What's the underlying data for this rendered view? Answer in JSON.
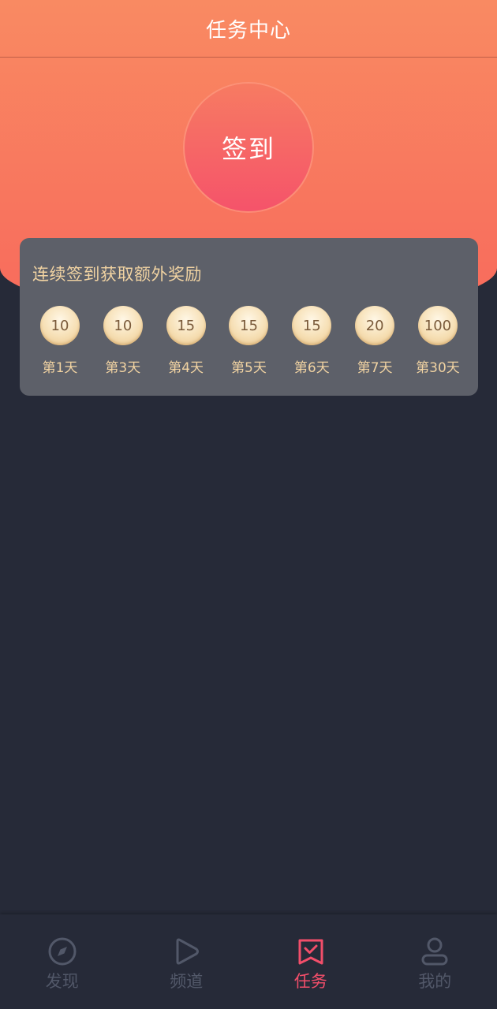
{
  "header": {
    "title": "任务中心"
  },
  "checkin": {
    "label": "签到"
  },
  "bonus_card": {
    "title": "连续签到获取额外奖励",
    "rewards": [
      {
        "amount": "10",
        "day": "第1天"
      },
      {
        "amount": "10",
        "day": "第3天"
      },
      {
        "amount": "15",
        "day": "第4天"
      },
      {
        "amount": "15",
        "day": "第5天"
      },
      {
        "amount": "15",
        "day": "第6天"
      },
      {
        "amount": "20",
        "day": "第7天"
      },
      {
        "amount": "100",
        "day": "第30天"
      }
    ]
  },
  "tabbar": {
    "tabs": [
      {
        "label": "发现",
        "icon": "compass-icon",
        "active": false
      },
      {
        "label": "频道",
        "icon": "play-icon",
        "active": false
      },
      {
        "label": "任务",
        "icon": "task-check-icon",
        "active": true
      },
      {
        "label": "我的",
        "icon": "user-icon",
        "active": false
      }
    ]
  },
  "colors": {
    "accent": "#f24e6a",
    "background": "#262a38",
    "card": "#5d6069",
    "gold_text": "#f1d3a2",
    "inactive": "#525869"
  }
}
